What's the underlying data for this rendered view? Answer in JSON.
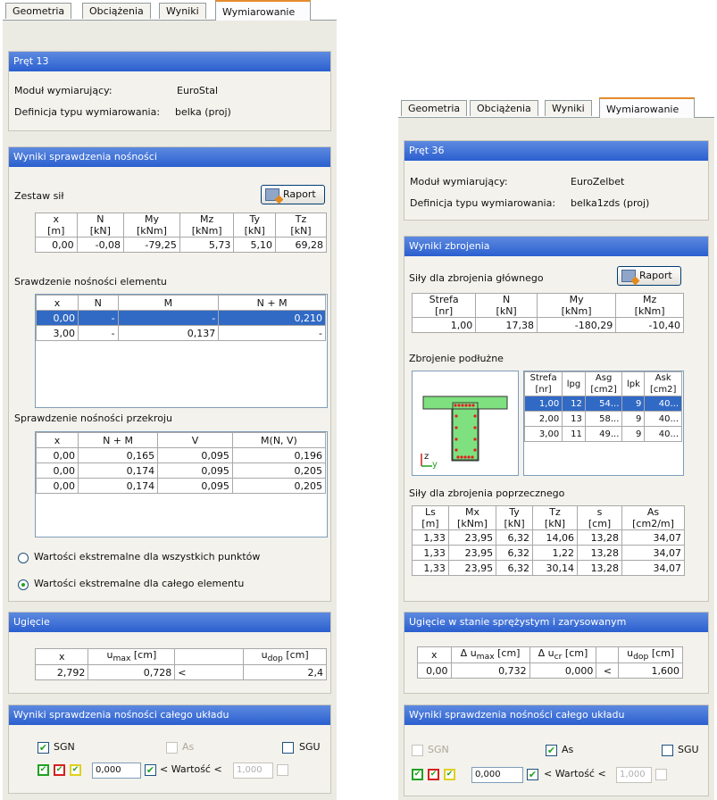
{
  "left": {
    "tabs": [
      "Geometria",
      "Obciążenia",
      "Wyniki",
      "Wymiarowanie"
    ],
    "header": {
      "title": "Pręt 13",
      "module_label": "Moduł wymiarujący:",
      "module_value": "EuroStal",
      "type_label": "Definicja typu wymiarowania:",
      "type_value": "belka (proj)"
    },
    "results": {
      "title": "Wyniki sprawdzenia nośności",
      "forces_label": "Zestaw sił",
      "report_button": "Raport",
      "forces_headers": [
        [
          "x",
          "[m]"
        ],
        [
          "N",
          "[kN]"
        ],
        [
          "My",
          "[kNm]"
        ],
        [
          "Mz",
          "[kNm]"
        ],
        [
          "Ty",
          "[kN]"
        ],
        [
          "Tz",
          "[kN]"
        ]
      ],
      "forces_row": [
        "0,00",
        "-0,08",
        "-79,25",
        "5,73",
        "5,10",
        "69,28"
      ],
      "element_label": "Srawdzenie nośności elementu",
      "element_headers": [
        "x",
        "N",
        "M",
        "N + M"
      ],
      "element_rows": [
        [
          "0,00",
          "-",
          "-",
          "0,210"
        ],
        [
          "3,00",
          "-",
          "0,137",
          "-"
        ]
      ],
      "section_label": "Sprawdzenie nośności przekroju",
      "section_headers": [
        "x",
        "N + M",
        "V",
        "M(N, V)"
      ],
      "section_rows": [
        [
          "0,00",
          "0,165",
          "0,095",
          "0,196"
        ],
        [
          "0,00",
          "0,174",
          "0,095",
          "0,205"
        ],
        [
          "0,00",
          "0,174",
          "0,095",
          "0,205"
        ]
      ],
      "radio1": "Wartości ekstremalne dla wszystkich punktów",
      "radio2": "Wartości ekstremalne dla całego elementu"
    },
    "deflection": {
      "title": "Ugięcie",
      "h_x": "x",
      "h_umax": "u",
      "h_umax_sub": "max",
      "h_umax_unit": " [cm]",
      "h_udop": "u",
      "h_udop_sub": "dop",
      "h_udop_unit": " [cm]",
      "x": "2,792",
      "umax": "0,728",
      "cmp": "<",
      "udop": "2,4"
    },
    "whole": {
      "title": "Wyniki sprawdzenia nośności całego układu",
      "sgn": "SGN",
      "as": "As",
      "sgu": "SGU",
      "value_from": "0,000",
      "value_label": "< Wartość <",
      "value_to": "1,000"
    }
  },
  "right": {
    "tabs": [
      "Geometria",
      "Obciążenia",
      "Wyniki",
      "Wymiarowanie"
    ],
    "header": {
      "title": "Pręt 36",
      "module_label": "Moduł wymiarujący:",
      "module_value": "EuroZelbet",
      "type_label": "Definicja typu wymiarowania:",
      "type_value": "belka1zds (proj)"
    },
    "reinf": {
      "title": "Wyniki zbrojenia",
      "main_label": "Siły dla zbrojenia głównego",
      "report_button": "Raport",
      "main_headers": [
        [
          "Strefa",
          "[nr]"
        ],
        [
          "N",
          "[kN]"
        ],
        [
          "My",
          "[kNm]"
        ],
        [
          "Mz",
          "[kNm]"
        ]
      ],
      "main_row": [
        "1,00",
        "17,38",
        "-180,29",
        "-10,40"
      ],
      "long_label": "Zbrojenie podłużne",
      "long_headers": [
        [
          "Strefa",
          "[nr]"
        ],
        [
          "lpg",
          ""
        ],
        [
          "Asg",
          "[cm2]"
        ],
        [
          "lpk",
          ""
        ],
        [
          "Ask",
          "[cm2]"
        ]
      ],
      "long_rows": [
        [
          "1,00",
          "12",
          "54...",
          "9",
          "40..."
        ],
        [
          "2,00",
          "13",
          "58...",
          "9",
          "40..."
        ],
        [
          "3,00",
          "11",
          "49...",
          "9",
          "40..."
        ]
      ],
      "axis_z": "z",
      "axis_y": "y",
      "shear_label": "Siły dla zbrojenia poprzecznego",
      "shear_headers": [
        [
          "Ls",
          "[m]"
        ],
        [
          "Mx",
          "[kNm]"
        ],
        [
          "Ty",
          "[kN]"
        ],
        [
          "Tz",
          "[kN]"
        ],
        [
          "s",
          "[cm]"
        ],
        [
          "As",
          "[cm2/m]"
        ]
      ],
      "shear_rows": [
        [
          "1,33",
          "23,95",
          "6,32",
          "14,06",
          "13,28",
          "34,07"
        ],
        [
          "1,33",
          "23,95",
          "6,32",
          "1,22",
          "13,28",
          "34,07"
        ],
        [
          "1,33",
          "23,95",
          "6,32",
          "30,14",
          "13,28",
          "34,07"
        ]
      ]
    },
    "deflection": {
      "title": "Ugięcie w stanie sprężystym i zarysowanym",
      "h_x": "x",
      "h_du": "Δ u",
      "h_du_sub": "max",
      "h_du_unit": " [cm]",
      "h_ucr": "Δ u",
      "h_ucr_sub": "cr",
      "h_ucr_unit": " [cm]",
      "h_udop": "u",
      "h_udop_sub": "dop",
      "h_udop_unit": " [cm]",
      "x": "0,00",
      "du": "0,732",
      "ucr": "0,000",
      "cmp": "<",
      "udop": "1,600"
    },
    "whole": {
      "title": "Wyniki sprawdzenia nośności całego układu",
      "sgn": "SGN",
      "as": "As",
      "sgu": "SGU",
      "value_from": "0,000",
      "value_label": "< Wartość <",
      "value_to": "1,000"
    }
  },
  "colors": {
    "header_blue": "#2b5fcf",
    "selection": "#316ac5",
    "panel_bg": "#ecebe3",
    "beam_green": "#7fe07f",
    "rebar_red": "#e02020"
  }
}
